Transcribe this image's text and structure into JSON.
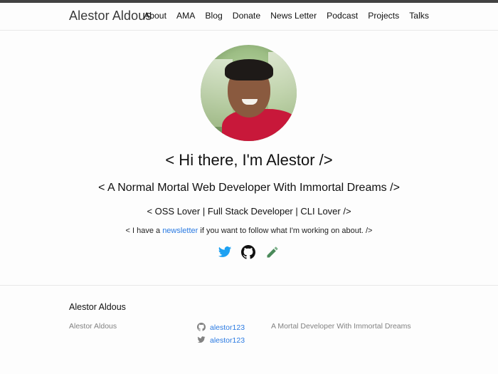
{
  "header": {
    "site_title": "Alestor Aldous",
    "nav": [
      "About",
      "AMA",
      "Blog",
      "Donate",
      "News Letter",
      "Podcast",
      "Projects",
      "Talks"
    ]
  },
  "hero": {
    "title": "< Hi there, I'm Alestor />",
    "subtitle": "< A Normal Mortal Web Developer With Immortal Dreams />",
    "roles": "< OSS Lover | Full Stack Developer | CLI Lover />",
    "note_prefix": "< I have a",
    "note_link": "newsletter",
    "note_suffix": "if you want to follow what I'm working on about. />",
    "social_icons": [
      "twitter-icon",
      "github-icon",
      "pencil-icon"
    ]
  },
  "footer": {
    "title": "Alestor Aldous",
    "name": "Alestor Aldous",
    "github_handle": "alestor123",
    "twitter_handle": "alestor123",
    "description": "A Mortal Developer With Immortal Dreams"
  },
  "colors": {
    "link": "#2a7ae2",
    "top_bar": "#424242",
    "twitter": "#1da1f2"
  }
}
